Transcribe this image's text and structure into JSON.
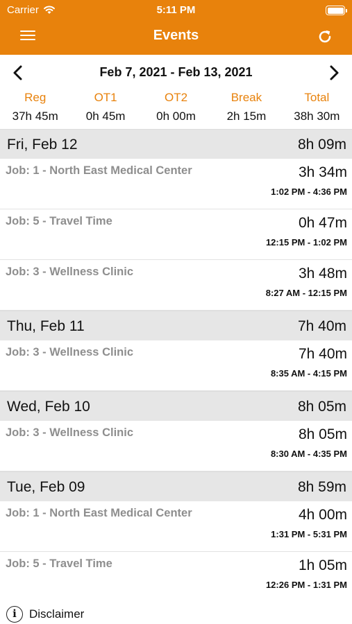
{
  "status_bar": {
    "carrier": "Carrier",
    "time": "5:11 PM"
  },
  "nav": {
    "title": "Events",
    "menu_icon": "hamburger-menu-icon",
    "refresh_icon": "refresh-icon"
  },
  "week": {
    "range": "Feb 7, 2021 - Feb 13, 2021"
  },
  "totals": {
    "labels": [
      "Reg",
      "OT1",
      "OT2",
      "Break",
      "Total"
    ],
    "values": [
      "37h 45m",
      "0h 45m",
      "0h 00m",
      "2h 15m",
      "38h 30m"
    ]
  },
  "days": [
    {
      "date": "Fri, Feb 12",
      "hours": "8h 09m",
      "entries": [
        {
          "job": "Job: 1 - North East Medical Center",
          "duration": "3h 34m",
          "span": "1:02 PM - 4:36 PM"
        },
        {
          "job": "Job: 5 - Travel Time",
          "duration": "0h 47m",
          "span": "12:15 PM - 1:02 PM"
        },
        {
          "job": "Job: 3 - Wellness Clinic",
          "duration": "3h 48m",
          "span": "8:27 AM - 12:15 PM"
        }
      ]
    },
    {
      "date": "Thu, Feb 11",
      "hours": "7h 40m",
      "entries": [
        {
          "job": "Job: 3 - Wellness Clinic",
          "duration": "7h 40m",
          "span": "8:35 AM - 4:15 PM"
        }
      ]
    },
    {
      "date": "Wed, Feb 10",
      "hours": "8h 05m",
      "entries": [
        {
          "job": "Job: 3 - Wellness Clinic",
          "duration": "8h 05m",
          "span": "8:30 AM - 4:35 PM"
        }
      ]
    },
    {
      "date": "Tue, Feb 09",
      "hours": "8h 59m",
      "entries": [
        {
          "job": "Job: 1 - North East Medical Center",
          "duration": "4h 00m",
          "span": "1:31 PM - 5:31 PM"
        },
        {
          "job": "Job: 5 - Travel Time",
          "duration": "1h 05m",
          "span": "12:26 PM - 1:31 PM"
        }
      ]
    }
  ],
  "footer": {
    "disclaimer": "Disclaimer"
  },
  "colors": {
    "accent": "#e8820c",
    "day_header_bg": "#e6e6e6",
    "job_text": "#8e8e8e"
  }
}
